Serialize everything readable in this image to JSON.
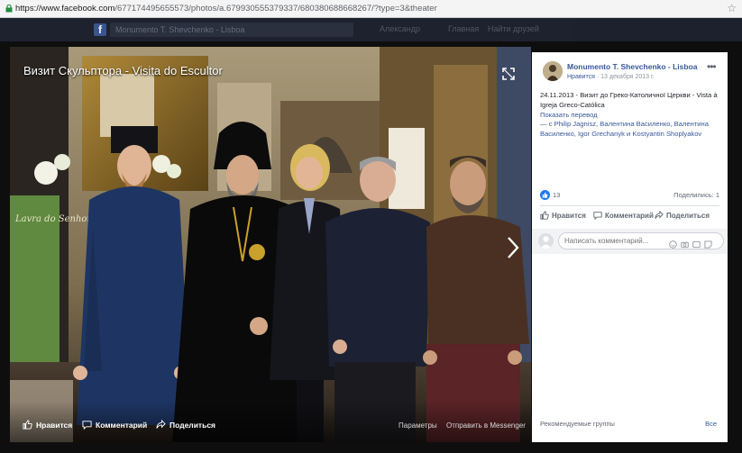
{
  "browser": {
    "url_domain": "https://www.facebook.com",
    "url_rest": "/677174495655573/photos/a.679930555379337/680380688668267/?type=3&theater"
  },
  "facebook_bar": {
    "logo": "f",
    "search_text": "Monumento T. Shevchenko - Lisboa",
    "nav": [
      "Александр",
      "Главная",
      "Найти друзей"
    ]
  },
  "photo": {
    "title": "Визит Скульптора - Visita do Escultor",
    "banner_text": "Lavra do Senhor",
    "actions": {
      "like": "Нравится",
      "comment": "Комментарий",
      "share": "Поделиться"
    },
    "options": "Параметры",
    "send_messenger": "Отправить в Messenger"
  },
  "post": {
    "page_name": "Monumento T. Shevchenko - Lisboa",
    "like_page": "Нравится",
    "separator": " · ",
    "date": "13 декабря 2013 г.",
    "text": "24.11.2013 - Визит до Греко-Католичної Церкви - Vista à Igreja Greco-Católica",
    "translate": "Показать перевод",
    "tags_prefix": "— с ",
    "tags_text": "Philip Jagnisz, Валентина Василенко, Валентина Василенко, Igor Grechanyk и Kostyantin Shoplyakov",
    "like_count": "13",
    "shares": "Поделились: 1",
    "actions": {
      "like": "Нравится",
      "comment": "Комментарий",
      "share": "Поделиться"
    },
    "comment_placeholder": "Написать комментарий...",
    "recommended_groups": "Рекомендуемые группы",
    "all": "Все"
  },
  "colors": {
    "fb_blue": "#385898",
    "like_blue": "#2078f4",
    "overlay_dark": "#0e0e0e"
  },
  "icons": [
    "lock-icon",
    "star-icon",
    "expand-icon",
    "next-arrow-icon",
    "like-icon",
    "comment-icon",
    "share-icon",
    "more-icon",
    "emoji-icon",
    "camera-icon",
    "gif-icon",
    "sticker-icon"
  ]
}
